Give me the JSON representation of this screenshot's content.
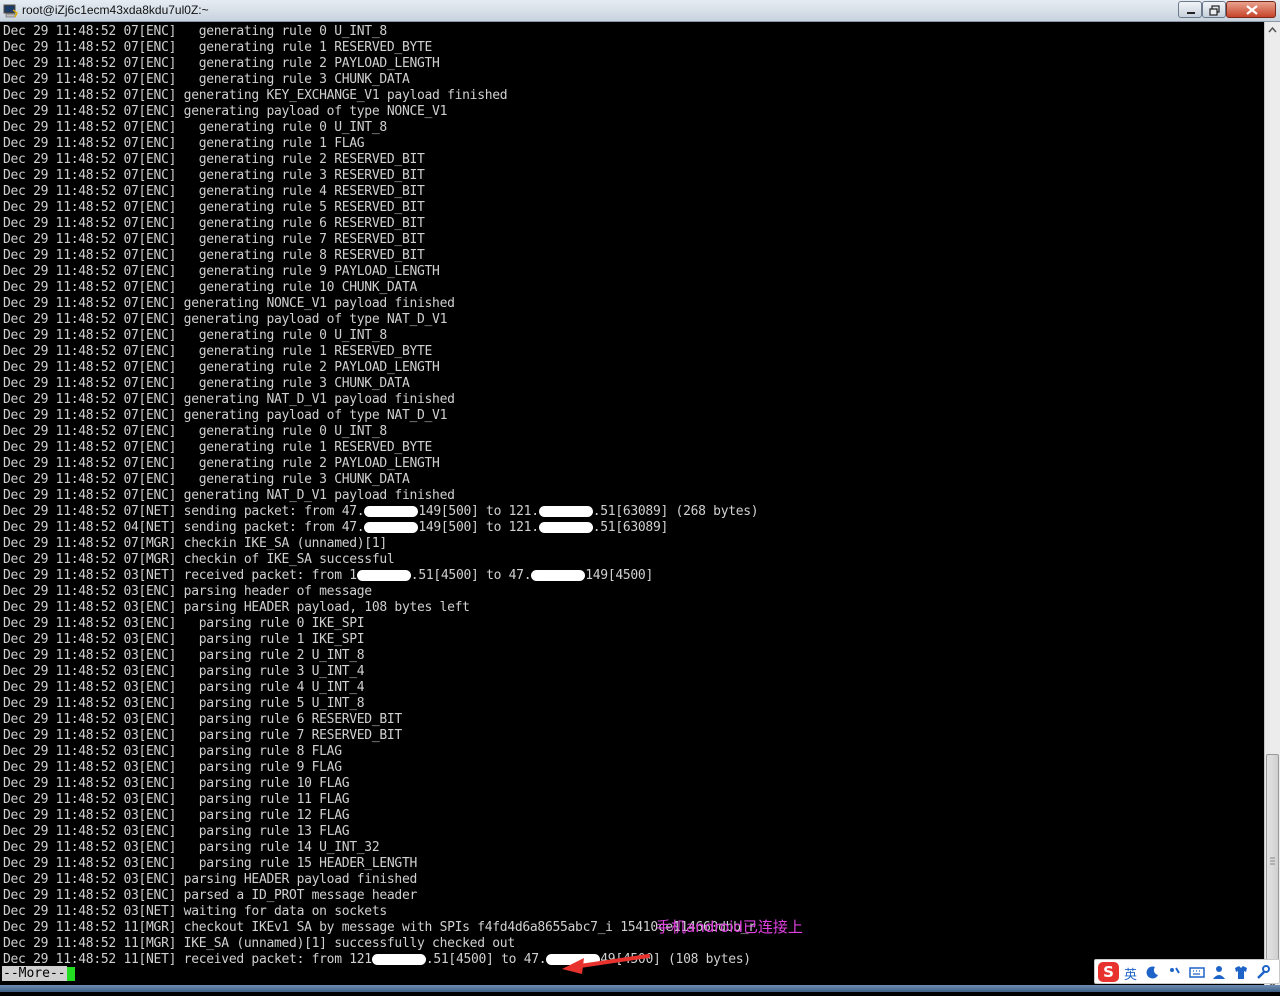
{
  "window": {
    "title": "root@iZj6c1ecm43xda8kdu7ul0Z:~"
  },
  "log_prefix": "Dec 29 11:48:52 ",
  "log_lines": [
    {
      "t": "07",
      "tag": "[ENC]",
      "msg": "  generating rule 0 U_INT_8"
    },
    {
      "t": "07",
      "tag": "[ENC]",
      "msg": "  generating rule 1 RESERVED_BYTE"
    },
    {
      "t": "07",
      "tag": "[ENC]",
      "msg": "  generating rule 2 PAYLOAD_LENGTH"
    },
    {
      "t": "07",
      "tag": "[ENC]",
      "msg": "  generating rule 3 CHUNK_DATA"
    },
    {
      "t": "07",
      "tag": "[ENC]",
      "msg": "generating KEY_EXCHANGE_V1 payload finished"
    },
    {
      "t": "07",
      "tag": "[ENC]",
      "msg": "generating payload of type NONCE_V1"
    },
    {
      "t": "07",
      "tag": "[ENC]",
      "msg": "  generating rule 0 U_INT_8"
    },
    {
      "t": "07",
      "tag": "[ENC]",
      "msg": "  generating rule 1 FLAG"
    },
    {
      "t": "07",
      "tag": "[ENC]",
      "msg": "  generating rule 2 RESERVED_BIT"
    },
    {
      "t": "07",
      "tag": "[ENC]",
      "msg": "  generating rule 3 RESERVED_BIT"
    },
    {
      "t": "07",
      "tag": "[ENC]",
      "msg": "  generating rule 4 RESERVED_BIT"
    },
    {
      "t": "07",
      "tag": "[ENC]",
      "msg": "  generating rule 5 RESERVED_BIT"
    },
    {
      "t": "07",
      "tag": "[ENC]",
      "msg": "  generating rule 6 RESERVED_BIT"
    },
    {
      "t": "07",
      "tag": "[ENC]",
      "msg": "  generating rule 7 RESERVED_BIT"
    },
    {
      "t": "07",
      "tag": "[ENC]",
      "msg": "  generating rule 8 RESERVED_BIT"
    },
    {
      "t": "07",
      "tag": "[ENC]",
      "msg": "  generating rule 9 PAYLOAD_LENGTH"
    },
    {
      "t": "07",
      "tag": "[ENC]",
      "msg": "  generating rule 10 CHUNK_DATA"
    },
    {
      "t": "07",
      "tag": "[ENC]",
      "msg": "generating NONCE_V1 payload finished"
    },
    {
      "t": "07",
      "tag": "[ENC]",
      "msg": "generating payload of type NAT_D_V1"
    },
    {
      "t": "07",
      "tag": "[ENC]",
      "msg": "  generating rule 0 U_INT_8"
    },
    {
      "t": "07",
      "tag": "[ENC]",
      "msg": "  generating rule 1 RESERVED_BYTE"
    },
    {
      "t": "07",
      "tag": "[ENC]",
      "msg": "  generating rule 2 PAYLOAD_LENGTH"
    },
    {
      "t": "07",
      "tag": "[ENC]",
      "msg": "  generating rule 3 CHUNK_DATA"
    },
    {
      "t": "07",
      "tag": "[ENC]",
      "msg": "generating NAT_D_V1 payload finished"
    },
    {
      "t": "07",
      "tag": "[ENC]",
      "msg": "generating payload of type NAT_D_V1"
    },
    {
      "t": "07",
      "tag": "[ENC]",
      "msg": "  generating rule 0 U_INT_8"
    },
    {
      "t": "07",
      "tag": "[ENC]",
      "msg": "  generating rule 1 RESERVED_BYTE"
    },
    {
      "t": "07",
      "tag": "[ENC]",
      "msg": "  generating rule 2 PAYLOAD_LENGTH"
    },
    {
      "t": "07",
      "tag": "[ENC]",
      "msg": "  generating rule 3 CHUNK_DATA"
    },
    {
      "t": "07",
      "tag": "[ENC]",
      "msg": "generating NAT_D_V1 payload finished"
    },
    {
      "t": "07",
      "tag": "[NET]",
      "msg": "sending packet: from 47.",
      "redact": true,
      "msg2": "149[500] to 121.",
      "redact2": true,
      "msg3": ".51[63089] (268 bytes)"
    },
    {
      "t": "04",
      "tag": "[NET]",
      "msg": "sending packet: from 47.",
      "redact": true,
      "msg2": "149[500] to 121.",
      "redact2": true,
      "msg3": ".51[63089]"
    },
    {
      "t": "07",
      "tag": "[MGR]",
      "msg": "checkin IKE_SA (unnamed)[1]"
    },
    {
      "t": "07",
      "tag": "[MGR]",
      "msg": "checkin of IKE_SA successful"
    },
    {
      "t": "03",
      "tag": "[NET]",
      "msg": "received packet: from 1",
      "redact": true,
      "msg2": ".51[4500] to 47.",
      "redact2": true,
      "msg3": "149[4500]"
    },
    {
      "t": "03",
      "tag": "[ENC]",
      "msg": "parsing header of message"
    },
    {
      "t": "03",
      "tag": "[ENC]",
      "msg": "parsing HEADER payload, 108 bytes left"
    },
    {
      "t": "03",
      "tag": "[ENC]",
      "msg": "  parsing rule 0 IKE_SPI"
    },
    {
      "t": "03",
      "tag": "[ENC]",
      "msg": "  parsing rule 1 IKE_SPI"
    },
    {
      "t": "03",
      "tag": "[ENC]",
      "msg": "  parsing rule 2 U_INT_8"
    },
    {
      "t": "03",
      "tag": "[ENC]",
      "msg": "  parsing rule 3 U_INT_4"
    },
    {
      "t": "03",
      "tag": "[ENC]",
      "msg": "  parsing rule 4 U_INT_4"
    },
    {
      "t": "03",
      "tag": "[ENC]",
      "msg": "  parsing rule 5 U_INT_8"
    },
    {
      "t": "03",
      "tag": "[ENC]",
      "msg": "  parsing rule 6 RESERVED_BIT"
    },
    {
      "t": "03",
      "tag": "[ENC]",
      "msg": "  parsing rule 7 RESERVED_BIT"
    },
    {
      "t": "03",
      "tag": "[ENC]",
      "msg": "  parsing rule 8 FLAG"
    },
    {
      "t": "03",
      "tag": "[ENC]",
      "msg": "  parsing rule 9 FLAG"
    },
    {
      "t": "03",
      "tag": "[ENC]",
      "msg": "  parsing rule 10 FLAG"
    },
    {
      "t": "03",
      "tag": "[ENC]",
      "msg": "  parsing rule 11 FLAG"
    },
    {
      "t": "03",
      "tag": "[ENC]",
      "msg": "  parsing rule 12 FLAG"
    },
    {
      "t": "03",
      "tag": "[ENC]",
      "msg": "  parsing rule 13 FLAG"
    },
    {
      "t": "03",
      "tag": "[ENC]",
      "msg": "  parsing rule 14 U_INT_32"
    },
    {
      "t": "03",
      "tag": "[ENC]",
      "msg": "  parsing rule 15 HEADER_LENGTH"
    },
    {
      "t": "03",
      "tag": "[ENC]",
      "msg": "parsing HEADER payload finished"
    },
    {
      "t": "03",
      "tag": "[ENC]",
      "msg": "parsed a ID_PROT message header"
    },
    {
      "t": "03",
      "tag": "[NET]",
      "msg": "waiting for data on sockets"
    },
    {
      "t": "11",
      "tag": "[MGR]",
      "msg": "checkout IKEv1 SA by message with SPIs f4fd4d6a8655abc7_i 15410ce114660dbb_r"
    },
    {
      "t": "11",
      "tag": "[MGR]",
      "msg": "IKE_SA (unnamed)[1] successfully checked out"
    },
    {
      "t": "11",
      "tag": "[NET]",
      "msg": "received packet: from 121",
      "redact": true,
      "msg2": ".51[4500] to 47.",
      "redact2": true,
      "msg3": "49[4500] (108 bytes)"
    }
  ],
  "pager": {
    "more_label": "--More--"
  },
  "annotation": {
    "text": "手机android已连接上",
    "color": "#e040e0",
    "arrow_color": "#e8322e"
  },
  "ime": {
    "logo": "S",
    "lang": "英"
  },
  "colors": {
    "terminal_bg": "#000000",
    "terminal_fg": "#d0d0d0",
    "cursor": "#22dd22"
  }
}
